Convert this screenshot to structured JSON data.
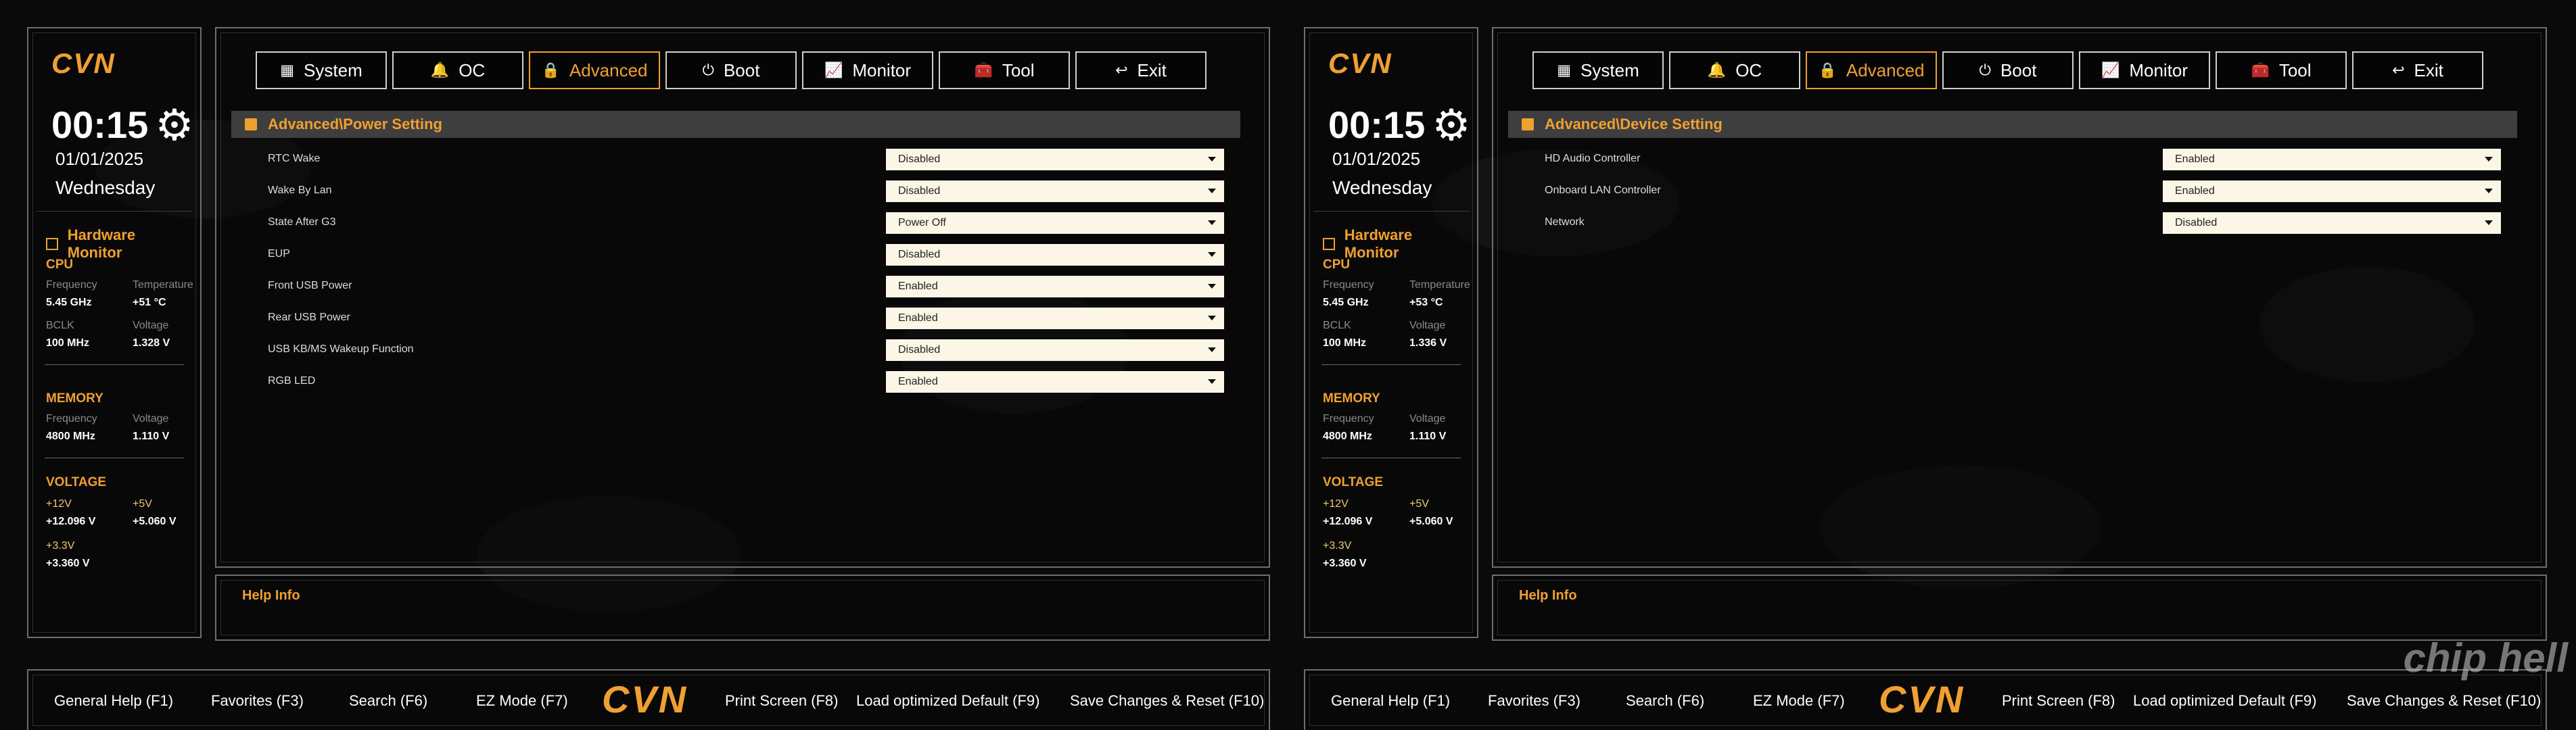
{
  "brand": {
    "logo_text": "CVN"
  },
  "screens": [
    {
      "left": {
        "time": "00:15",
        "date": "01/01/2025",
        "day": "Wednesday",
        "hm_title": "Hardware Monitor",
        "cpu": {
          "title": "CPU",
          "freq_label": "Frequency",
          "freq_val": "5.45 GHz",
          "temp_label": "Temperature",
          "temp_val": "+51 °C",
          "bclk_label": "BCLK",
          "bclk_val": "100 MHz",
          "volt_label": "Voltage",
          "volt_val": "1.328 V"
        },
        "memory": {
          "title": "MEMORY",
          "freq_label": "Frequency",
          "freq_val": "4800 MHz",
          "volt_label": "Voltage",
          "volt_val": "1.110 V"
        },
        "voltage": {
          "title": "VOLTAGE",
          "v12_label": "+12V",
          "v12_val": "+12.096 V",
          "v5_label": "+5V",
          "v5_val": "+5.060 V",
          "v33_label": "+3.3V",
          "v33_val": "+3.360 V"
        }
      },
      "tabs": [
        {
          "label": "System",
          "icon": "grid-icon",
          "glyph": "▦"
        },
        {
          "label": "OC",
          "icon": "bell-icon",
          "glyph": "🔔"
        },
        {
          "label": "Advanced",
          "icon": "lock-icon",
          "glyph": "🔒"
        },
        {
          "label": "Boot",
          "icon": "power-icon",
          "glyph": "⏻"
        },
        {
          "label": "Monitor",
          "icon": "monitor-icon",
          "glyph": "📈"
        },
        {
          "label": "Tool",
          "icon": "toolbox-icon",
          "glyph": "🧰"
        },
        {
          "label": "Exit",
          "icon": "back-arrow-icon",
          "glyph": "↩"
        }
      ],
      "active_tab": "Advanced",
      "breadcrumb": "Advanced\\Power Setting",
      "settings": [
        {
          "label": "RTC Wake",
          "value": "Disabled"
        },
        {
          "label": "Wake By Lan",
          "value": "Disabled"
        },
        {
          "label": "State After G3",
          "value": "Power Off"
        },
        {
          "label": "EUP",
          "value": "Disabled"
        },
        {
          "label": "Front USB Power",
          "value": "Enabled"
        },
        {
          "label": "Rear USB Power",
          "value": "Enabled"
        },
        {
          "label": "USB KB/MS Wakeup Function",
          "value": "Disabled"
        },
        {
          "label": "RGB LED",
          "value": "Enabled"
        }
      ],
      "help_title": "Help Info"
    },
    {
      "left": {
        "time": "00:15",
        "date": "01/01/2025",
        "day": "Wednesday",
        "hm_title": "Hardware Monitor",
        "cpu": {
          "title": "CPU",
          "freq_label": "Frequency",
          "freq_val": "5.45 GHz",
          "temp_label": "Temperature",
          "temp_val": "+53 °C",
          "bclk_label": "BCLK",
          "bclk_val": "100 MHz",
          "volt_label": "Voltage",
          "volt_val": "1.336 V"
        },
        "memory": {
          "title": "MEMORY",
          "freq_label": "Frequency",
          "freq_val": "4800 MHz",
          "volt_label": "Voltage",
          "volt_val": "1.110 V"
        },
        "voltage": {
          "title": "VOLTAGE",
          "v12_label": "+12V",
          "v12_val": "+12.096 V",
          "v5_label": "+5V",
          "v5_val": "+5.060 V",
          "v33_label": "+3.3V",
          "v33_val": "+3.360 V"
        }
      },
      "tabs": [
        {
          "label": "System",
          "icon": "grid-icon",
          "glyph": "▦"
        },
        {
          "label": "OC",
          "icon": "bell-icon",
          "glyph": "🔔"
        },
        {
          "label": "Advanced",
          "icon": "lock-icon",
          "glyph": "🔒"
        },
        {
          "label": "Boot",
          "icon": "power-icon",
          "glyph": "⏻"
        },
        {
          "label": "Monitor",
          "icon": "monitor-icon",
          "glyph": "📈"
        },
        {
          "label": "Tool",
          "icon": "toolbox-icon",
          "glyph": "🧰"
        },
        {
          "label": "Exit",
          "icon": "back-arrow-icon",
          "glyph": "↩"
        }
      ],
      "active_tab": "Advanced",
      "breadcrumb": "Advanced\\Device Setting",
      "settings": [
        {
          "label": "HD Audio Controller",
          "value": "Enabled"
        },
        {
          "label": "Onboard LAN Controller",
          "value": "Enabled"
        },
        {
          "label": "Network",
          "value": "Disabled"
        }
      ],
      "help_title": "Help Info"
    }
  ],
  "bottom_keys": [
    "General Help (F1)",
    "Favorites (F3)",
    "Search (F6)",
    "EZ Mode (F7)",
    "Print Screen (F8)",
    "Load optimized Default (F9)",
    "Save Changes & Reset (F10)"
  ],
  "watermark": "chip hell",
  "colors": {
    "accent": "#f0a030",
    "select_bg": "#fcf6e6",
    "breadcrumb_bg": "#3e3e3e"
  }
}
